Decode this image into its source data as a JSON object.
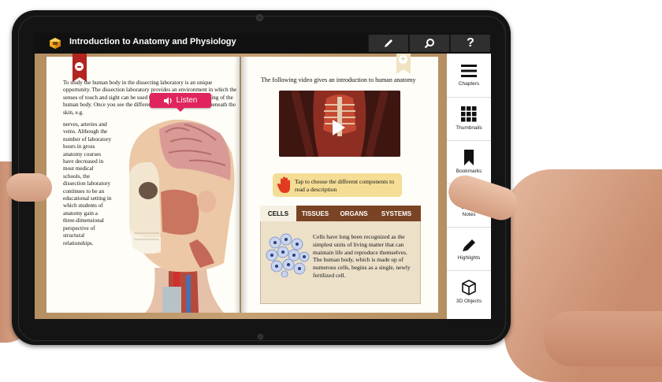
{
  "app": {
    "title": "Introduction to Anatomy and Physiology"
  },
  "toolbar": {
    "pencil_icon": "pencil-icon",
    "search_icon": "search-icon",
    "help_label": "?"
  },
  "left_page": {
    "para1": "To study the human body in the dissecting laboratory is an unique opportunity. The dissection laboratory provides an environment in which the senses of touch and sight can be used to enhance your understanding of the human body. Once you see the different structures which course beneath the skin, e.g.",
    "para2": "nerves, arteries and veins. Although the number of laboratory hours in gross anatomy courses have decreased in most medical schools, the dissection laboratory continues to be an educational setting in which students of anatomy gain a three-dimensional perspective of structural relationships.",
    "listen_label": "Listen"
  },
  "right_page": {
    "intro": "The following video gives an introduction to human anatomy",
    "tap_text": "Tap to choose the different components to read a description",
    "tabs": [
      {
        "label": "CELLS",
        "active": true
      },
      {
        "label": "TISSUES",
        "active": false
      },
      {
        "label": "ORGANS",
        "active": false
      },
      {
        "label": "SYSTEMS",
        "active": false
      }
    ],
    "cells_text": "Cells have long been recognized as the simplest units of living matter that can maintain life and reproduce themselves. The human body, which is made up of numerous cells, begins as a single, newly fertilized cell."
  },
  "sidebar": {
    "items": [
      {
        "label": "Chapters",
        "icon": "menu-icon"
      },
      {
        "label": "Thumbnails",
        "icon": "grid-icon"
      },
      {
        "label": "Bookmarks",
        "icon": "bookmark-icon"
      },
      {
        "label": "Notes",
        "icon": "notes-icon"
      },
      {
        "label": "Highlights",
        "icon": "highlighter-icon"
      },
      {
        "label": "3D Objects",
        "icon": "cube-icon"
      }
    ]
  },
  "colors": {
    "accent_pink": "#e0245e",
    "tab_brown": "#7a4424",
    "bookmark_red": "#b3231f"
  }
}
